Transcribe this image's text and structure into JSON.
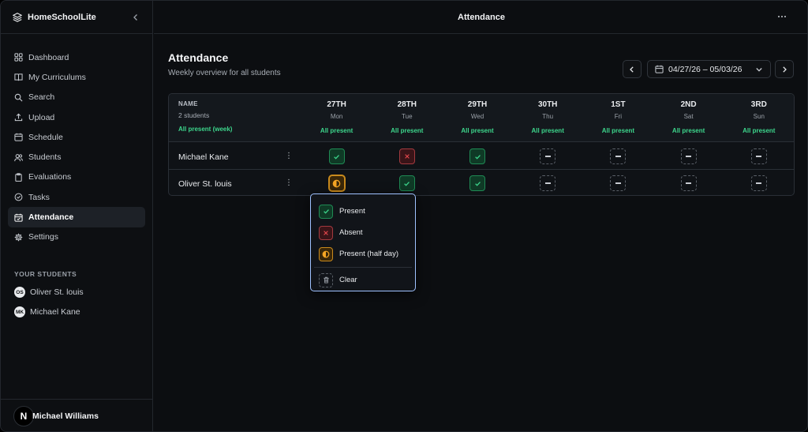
{
  "app": {
    "name": "HomeSchoolLite"
  },
  "sidebar": {
    "items": [
      {
        "label": "Dashboard",
        "icon": "grid-icon"
      },
      {
        "label": "My Curriculums",
        "icon": "book-icon"
      },
      {
        "label": "Search",
        "icon": "search-icon"
      },
      {
        "label": "Upload",
        "icon": "upload-icon"
      },
      {
        "label": "Schedule",
        "icon": "calendar-icon"
      },
      {
        "label": "Students",
        "icon": "users-icon"
      },
      {
        "label": "Evaluations",
        "icon": "clipboard-icon"
      },
      {
        "label": "Tasks",
        "icon": "check-circle-icon"
      },
      {
        "label": "Attendance",
        "icon": "calendar-check-icon",
        "active": true
      },
      {
        "label": "Settings",
        "icon": "gear-icon"
      }
    ],
    "students_heading": "YOUR STUDENTS",
    "students": [
      {
        "initials": "OS",
        "name": "Oliver St. louis"
      },
      {
        "initials": "MK",
        "name": "Michael Kane"
      }
    ],
    "user": {
      "initial": "N",
      "name": "Michael Williams"
    }
  },
  "topbar": {
    "title": "Attendance",
    "more": "···"
  },
  "page": {
    "title": "Attendance",
    "subtitle": "Weekly overview for all students",
    "date_range": "04/27/26 – 05/03/26"
  },
  "table": {
    "name_header": "NAME",
    "student_count": "2 students",
    "all_present_week": "All present (week)",
    "days": [
      {
        "num": "27TH",
        "name": "Mon",
        "action": "All present"
      },
      {
        "num": "28TH",
        "name": "Tue",
        "action": "All present"
      },
      {
        "num": "29TH",
        "name": "Wed",
        "action": "All present"
      },
      {
        "num": "30TH",
        "name": "Thu",
        "action": "All present"
      },
      {
        "num": "1ST",
        "name": "Fri",
        "action": "All present"
      },
      {
        "num": "2ND",
        "name": "Sat",
        "action": "All present"
      },
      {
        "num": "3RD",
        "name": "Sun",
        "action": "All present"
      }
    ],
    "rows": [
      {
        "name": "Michael Kane",
        "menu": "⋮",
        "status": [
          "present",
          "absent",
          "present",
          "empty",
          "empty",
          "empty",
          "empty"
        ]
      },
      {
        "name": "Oliver St. louis",
        "menu": "⋮",
        "status": [
          "half",
          "present",
          "present",
          "empty",
          "empty",
          "empty",
          "empty"
        ]
      }
    ]
  },
  "status_menu": {
    "options": [
      {
        "label": "Present",
        "icon": "check-icon"
      },
      {
        "label": "Absent",
        "icon": "x-icon"
      },
      {
        "label": "Present (half day)",
        "icon": "half-circle-icon"
      },
      {
        "label": "Clear",
        "icon": "trash-icon"
      }
    ]
  },
  "colors": {
    "present": "#3dd68c",
    "absent": "#e5484d",
    "half": "#f5a524",
    "accent_border": "#9fc2ff"
  }
}
